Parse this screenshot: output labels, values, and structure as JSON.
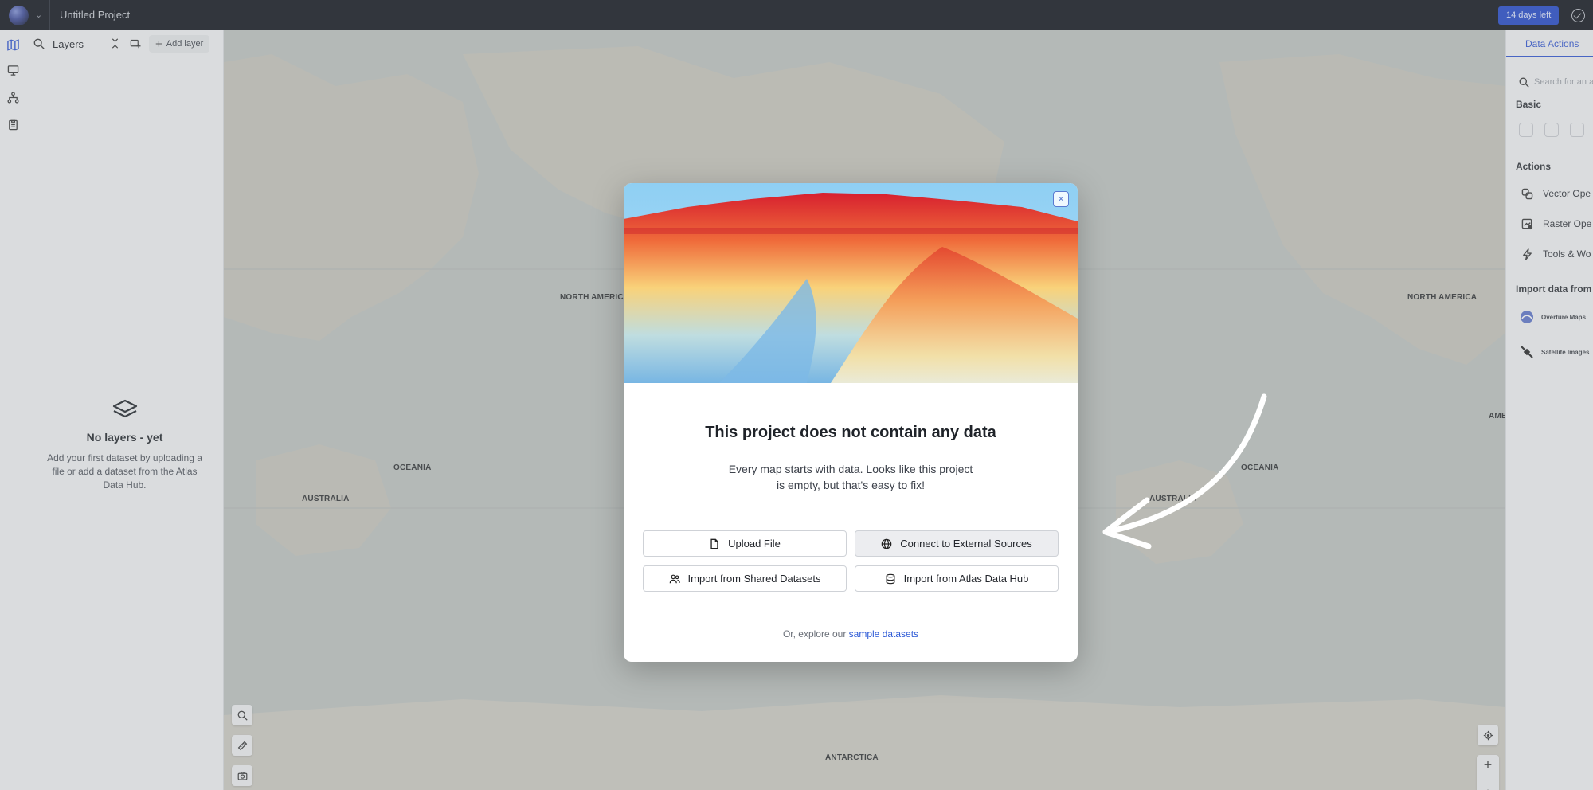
{
  "topbar": {
    "project_title": "Untitled Project",
    "trial_badge": "14 days left"
  },
  "layers_panel": {
    "title": "Layers",
    "add_layer_label": "Add layer",
    "empty_title": "No layers - yet",
    "empty_desc": "Add your first dataset by uploading a file or add a dataset from the Atlas Data Hub."
  },
  "map": {
    "labels": {
      "north_america_left": "NORTH AMERICA",
      "north_america_right": "NORTH AMERICA",
      "oceania_left": "OCEANIA",
      "oceania_right": "OCEANIA",
      "australia_left": "AUSTRALIA",
      "australia_right": "AUSTRALIA",
      "antarctica": "ANTARCTICA",
      "america_edge": "AME"
    },
    "zoom_level": "1"
  },
  "right_panel": {
    "tab_label": "Data Actions",
    "search_placeholder": "Search for an a",
    "basic_heading": "Basic",
    "actions_heading": "Actions",
    "actions": [
      {
        "label": "Vector Ope",
        "icon": "vector-icon"
      },
      {
        "label": "Raster Ope",
        "icon": "raster-icon"
      },
      {
        "label": "Tools & Wo",
        "icon": "lightning-icon"
      }
    ],
    "import_heading": "Import data from",
    "sources": [
      {
        "label": "Overture Maps",
        "icon": "overture-icon"
      },
      {
        "label": "Satellite Images",
        "icon": "satellite-icon"
      }
    ]
  },
  "modal": {
    "title": "This project does not contain any data",
    "description": "Every map starts with data. Looks like this project is empty, but that's easy to fix!",
    "buttons": {
      "upload": "Upload File",
      "connect": "Connect to External Sources",
      "shared": "Import from Shared Datasets",
      "atlas": "Import from Atlas Data Hub"
    },
    "footer_prefix": "Or, explore our ",
    "footer_link": "sample datasets"
  }
}
